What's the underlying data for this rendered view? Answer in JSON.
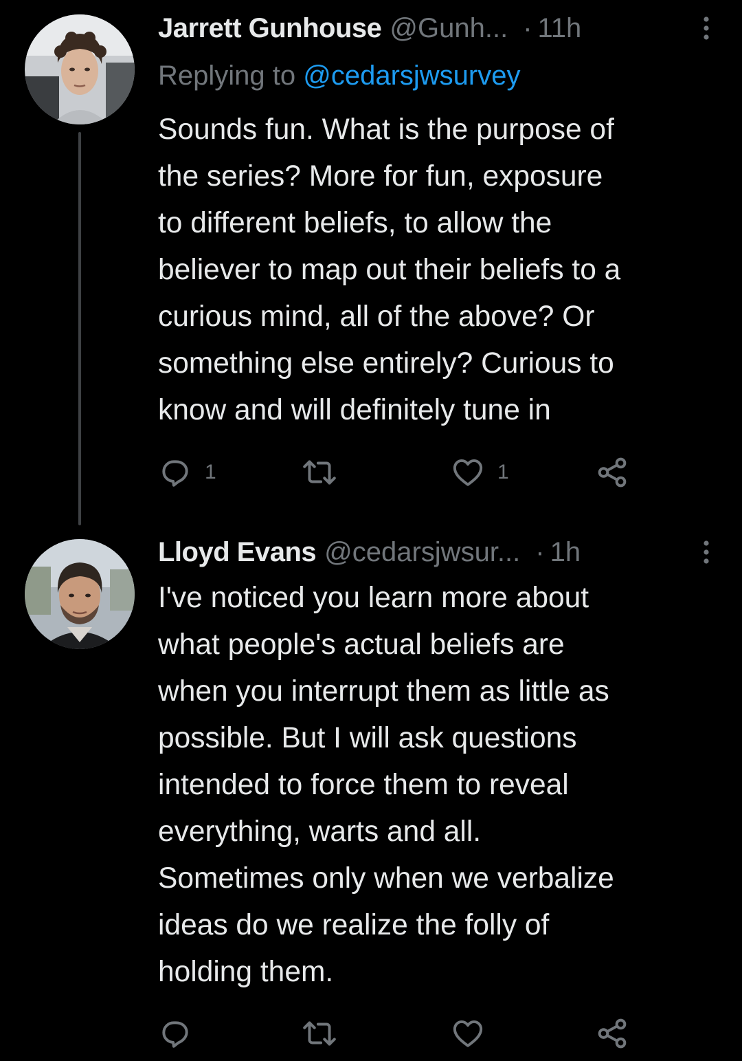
{
  "tweets": [
    {
      "name": "Jarrett Gunhouse",
      "handle": "@Gunh...",
      "dot": "·",
      "time": "11h",
      "reply_prefix": "Replying to ",
      "reply_mention": "@cedarsjwsurvey",
      "text_lines": [
        "Sounds fun. What is the purpose of",
        "the series? More for fun, exposure",
        "to different beliefs, to allow the",
        "believer to map out their beliefs to a",
        "curious mind, all of the above? Or",
        "something else entirely? Curious to",
        "know and will definitely tune in"
      ],
      "reply_count": "1",
      "retweet_count": "",
      "like_count": "1"
    },
    {
      "name": "Lloyd Evans",
      "handle": "@cedarsjwsur...",
      "dot": "·",
      "time": "1h",
      "text_lines": [
        "I've noticed you learn more about",
        "what people's actual beliefs are",
        "when you interrupt them as little as",
        "possible. But I will ask questions",
        "intended to force them to reveal",
        "everything, warts and all.",
        "Sometimes only when we verbalize",
        "ideas do we realize the folly of",
        "holding them."
      ],
      "reply_count": "",
      "retweet_count": "",
      "like_count": ""
    }
  ],
  "icons": {
    "more": "more-vertical-icon",
    "reply": "reply-bubble-icon",
    "retweet": "retweet-icon",
    "like": "heart-icon",
    "share": "share-icon"
  },
  "colors": {
    "background": "#000000",
    "text": "#e7e9ea",
    "secondary": "#71767b",
    "link": "#1d9bf0",
    "thread_line": "#3e4144"
  }
}
